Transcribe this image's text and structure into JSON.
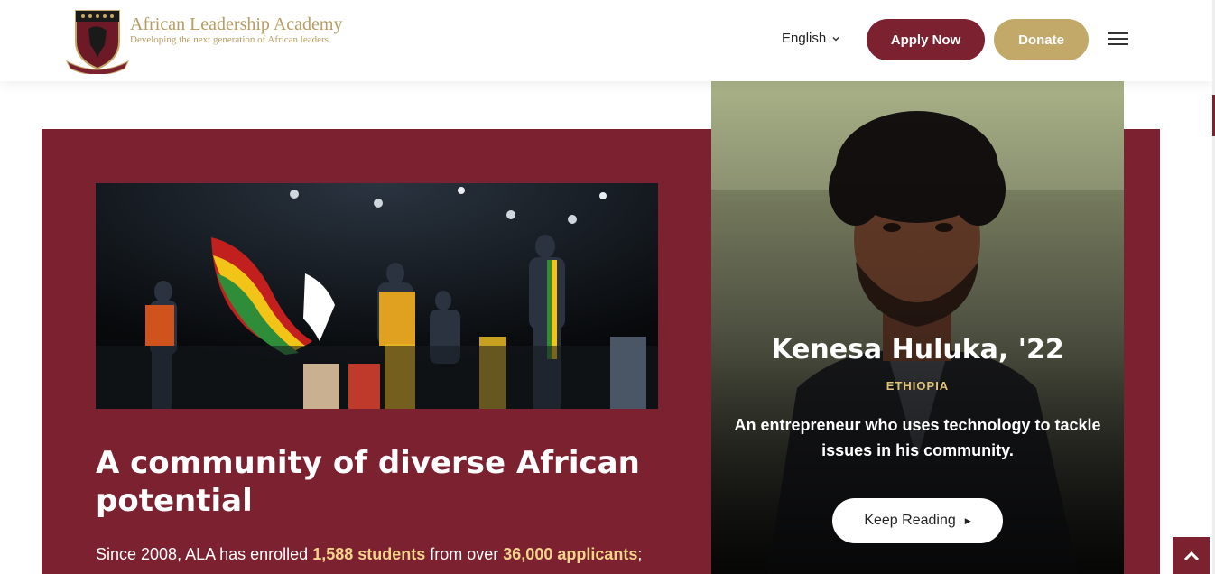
{
  "header": {
    "brand_name": "African Leadership Academy",
    "brand_tagline": "Developing the next generation of African leaders",
    "language": "English",
    "apply_label": "Apply Now",
    "donate_label": "Donate"
  },
  "main": {
    "headline": "A community of diverse African potential",
    "para_prefix": "Since 2008, ALA has enrolled ",
    "para_students": "1,588 students",
    "para_mid": " from over ",
    "para_applicants": "36,000 applicants",
    "para_suffix": ";"
  },
  "profile": {
    "name": "Kenesa Huluka, '22",
    "country": "ETHIOPIA",
    "description": "An entrepreneur who uses technology to tackle issues in his community.",
    "button_label": "Keep Reading"
  },
  "colors": {
    "maroon": "#7b2130",
    "gold": "#c2a96a",
    "highlight": "#f2d38a"
  }
}
